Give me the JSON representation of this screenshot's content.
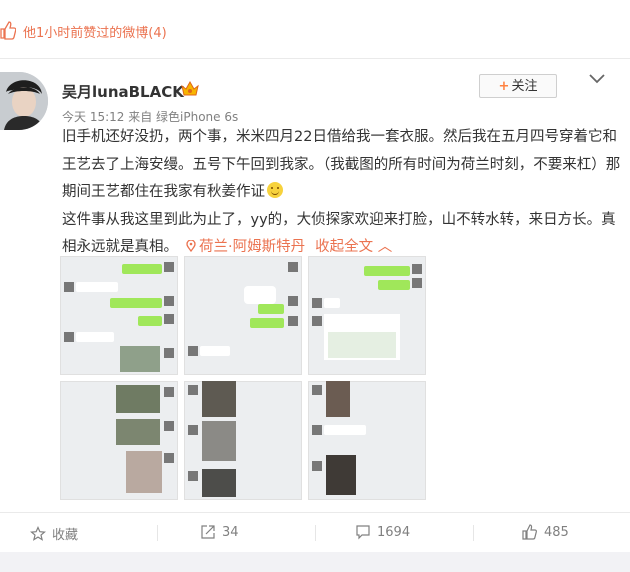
{
  "liked_header": {
    "text": "他1小时前赞过的微博(4)"
  },
  "author": {
    "name": "吴月lunaBLACK",
    "meta": "今天 15:12 来自 绿色iPhone 6s",
    "follow_label": "关注"
  },
  "post": {
    "paragraph_1": "旧手机还好没扔，两个事，米米四月22日借给我一套衣服。然后我在五月四号穿着它和王艺去了上海安缦。五号下午回到我家。（我截图的所有时间为荷兰时刻，不要来杠）那期间王艺都住在我家有秋姜作证",
    "paragraph_2": "这件事从我这里到此为止了，yy的，大侦探家欢迎来打脸，山不转水转，来日方长。真相永远就是真相。",
    "location": "荷兰·阿姆斯特丹",
    "expand_label": "收起全文 ︿"
  },
  "footer": {
    "favorite_label": "收藏",
    "repost_count": "34",
    "comment_count": "1694",
    "like_count": "485"
  },
  "colors": {
    "accent": "#eb7350",
    "chat_green": "#a0e75a"
  },
  "icons": [
    "thumbs-up-icon",
    "vip-badge-icon",
    "chevron-down-icon",
    "location-pin-icon",
    "star-icon",
    "share-icon",
    "comment-icon",
    "like-icon"
  ]
}
